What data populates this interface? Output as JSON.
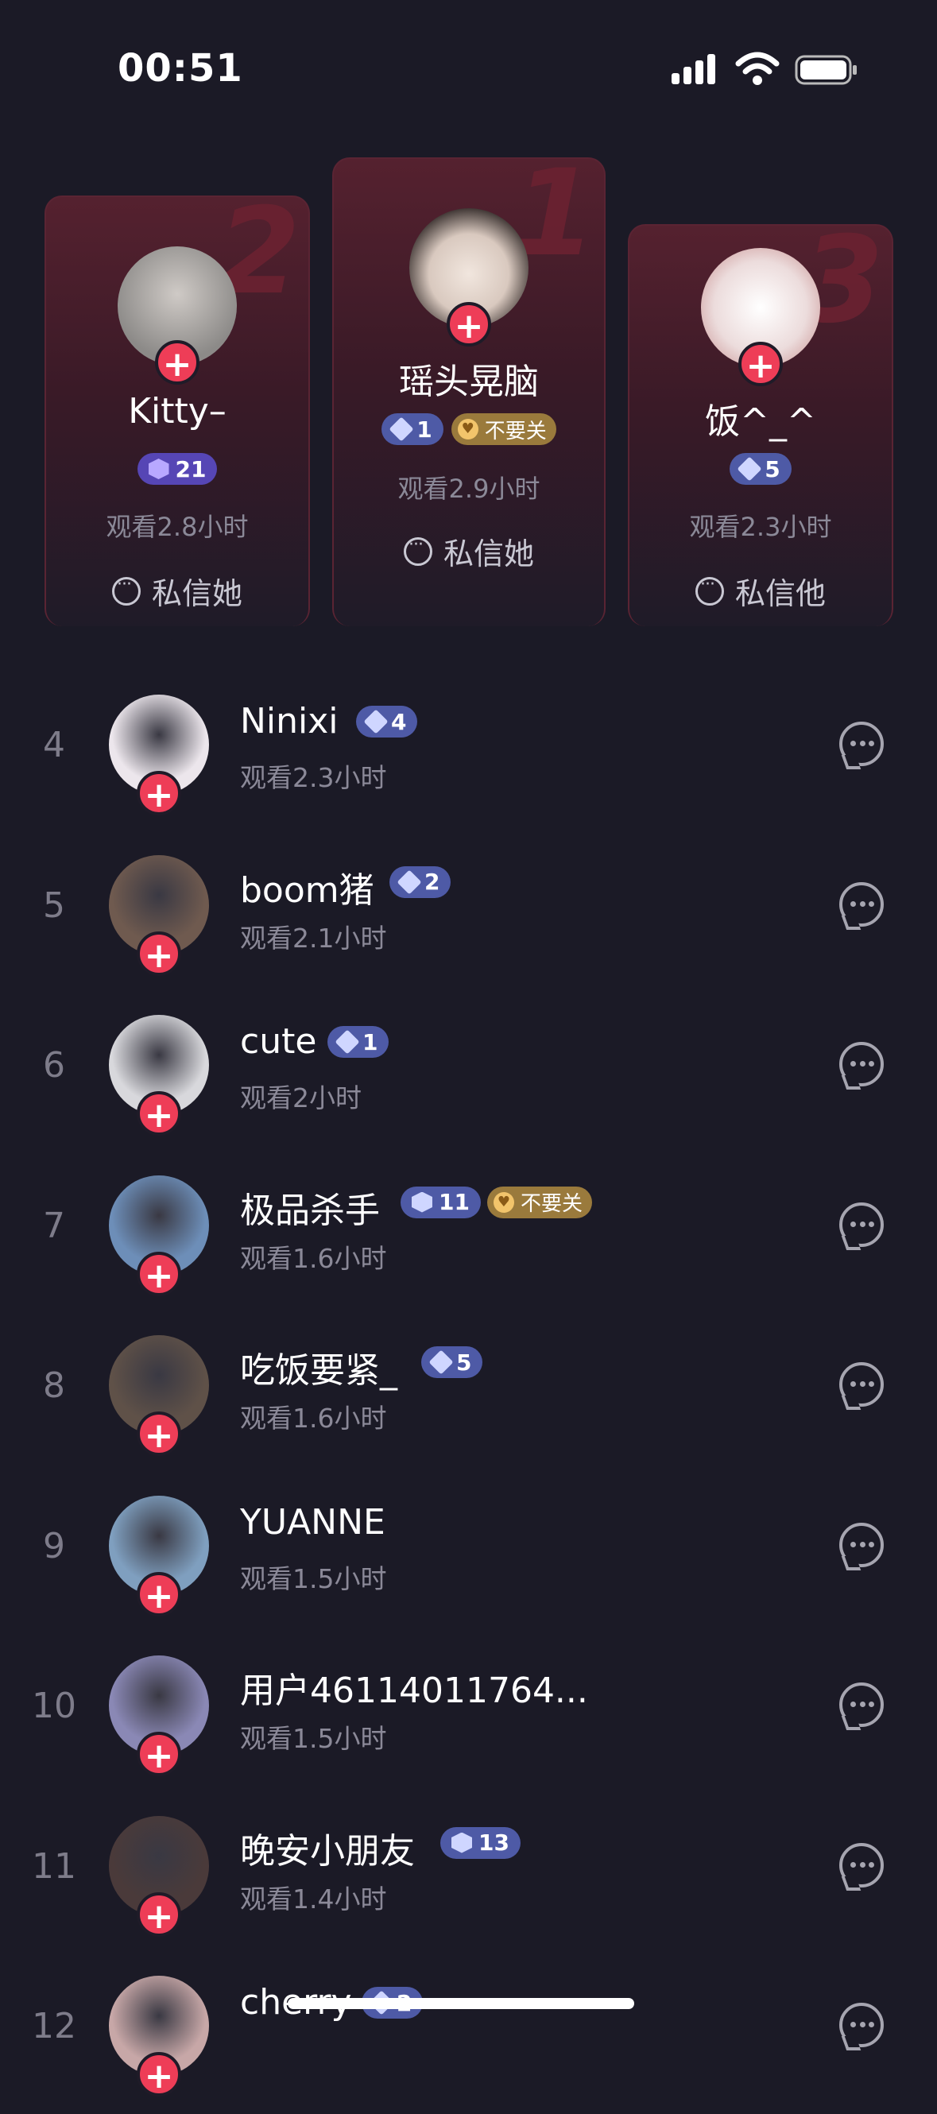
{
  "status": {
    "time": "00:51"
  },
  "podium": [
    {
      "rank": "2",
      "name": "Kitty–",
      "badge": "21",
      "watch": "观看2.8小时",
      "dm": "私信她",
      "avatar_color": "#8c8a88"
    },
    {
      "rank": "1",
      "name": "瑶头晃脑",
      "badge": "1",
      "tag": "不要关",
      "watch": "观看2.9小时",
      "dm": "私信她",
      "avatar_color": "#d9c9bf"
    },
    {
      "rank": "3",
      "name": "饭^_^",
      "badge": "5",
      "watch": "观看2.3小时",
      "dm": "私信他",
      "avatar_color": "#e9d6d6"
    }
  ],
  "list": [
    {
      "rank": "4",
      "name": "Ninixi",
      "badge": "4",
      "watch": "观看2.3小时",
      "avatar_color": "#ece6ec"
    },
    {
      "rank": "5",
      "name": "boom猪",
      "badge": "2",
      "watch": "观看2.1小时",
      "avatar_color": "#6f5a4f"
    },
    {
      "rank": "6",
      "name": "cute",
      "badge": "1",
      "watch": "观看2小时",
      "avatar_color": "#d8d8dc"
    },
    {
      "rank": "7",
      "name": "极品杀手",
      "badge": "11",
      "tag": "不要关",
      "watch": "观看1.6小时",
      "avatar_color": "#6d8eb8"
    },
    {
      "rank": "8",
      "name": "吃饭要紧_",
      "badge": "5",
      "watch": "观看1.6小时",
      "avatar_color": "#5f5148"
    },
    {
      "rank": "9",
      "name": "YUANNE",
      "watch": "观看1.5小时",
      "avatar_color": "#7f9fbf"
    },
    {
      "rank": "10",
      "name": "用户46114011764...",
      "watch": "观看1.5小时",
      "avatar_color": "#8a88b5"
    },
    {
      "rank": "11",
      "name": "晚安小朋友",
      "badge": "13",
      "watch": "观看1.4小时",
      "avatar_color": "#4a3a3a"
    },
    {
      "rank": "12",
      "name": "cherry",
      "badge": "2",
      "watch": "",
      "avatar_color": "#c7a7a7"
    }
  ],
  "icons": {
    "plus": "+"
  }
}
